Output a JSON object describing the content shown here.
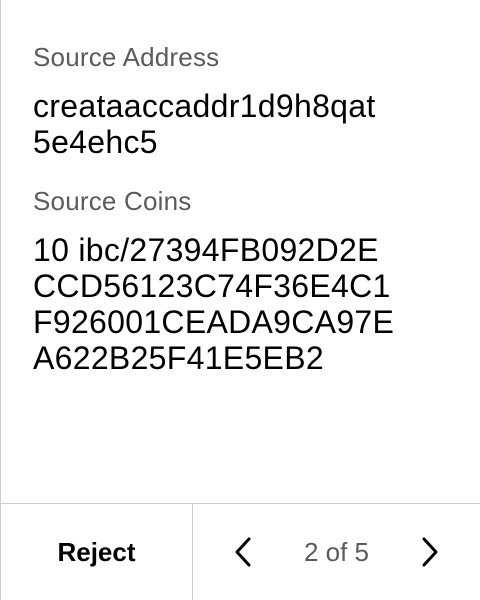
{
  "fields": {
    "source_address": {
      "label": "Source Address",
      "value_lines": [
        "creataaccaddr1d9h8qat",
        "5e4ehc5"
      ]
    },
    "source_coins": {
      "label": "Source Coins",
      "value_lines": [
        "10 ibc/27394FB092D2E",
        "CCD56123C74F36E4C1",
        "F926001CEADA9CA97E",
        "A622B25F41E5EB2"
      ]
    }
  },
  "footer": {
    "reject_label": "Reject",
    "page_indicator": "2 of 5",
    "prev_icon": "chevron-left-icon",
    "next_icon": "chevron-right-icon"
  },
  "colors": {
    "label_gray": "#5b5b5b",
    "divider": "#cfcfcf",
    "text": "#000000"
  }
}
